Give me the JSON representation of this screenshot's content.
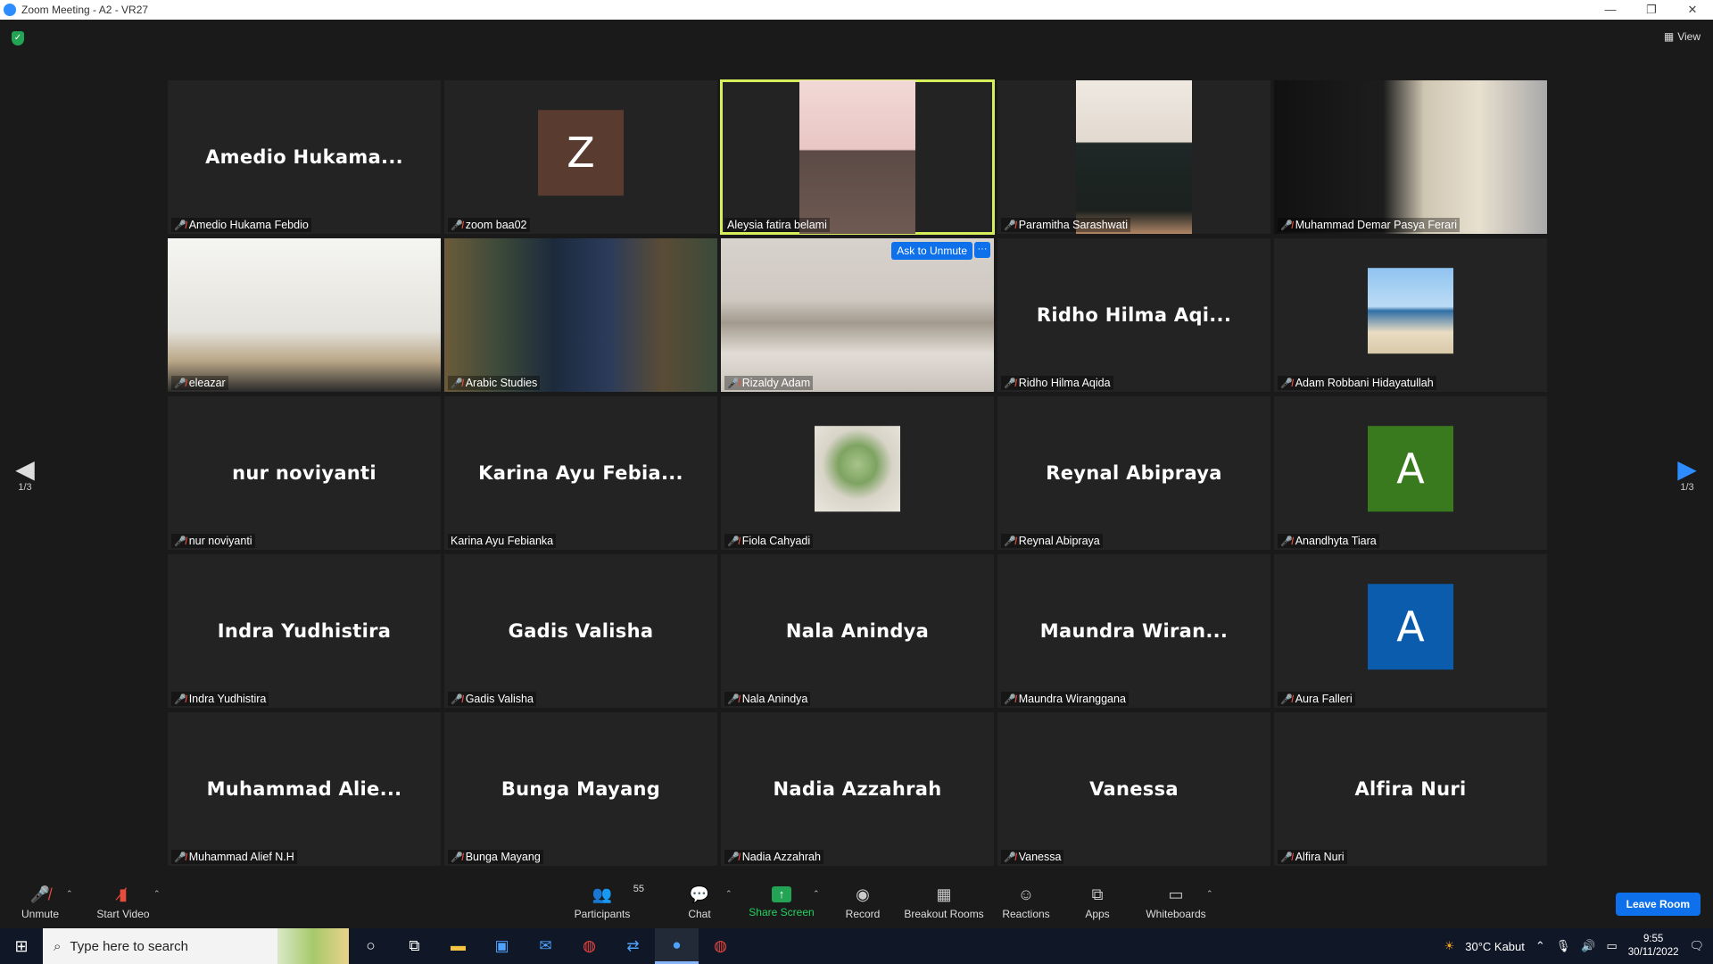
{
  "window": {
    "title": "Zoom Meeting - A2 - VR27",
    "controls": [
      "—",
      "❐",
      "✕"
    ]
  },
  "view_button": {
    "label": "View"
  },
  "pagination": {
    "left": "1/3",
    "right": "1/3"
  },
  "tiles": [
    {
      "big": "Amedio  Hukama...",
      "label": "Amedio Hukama Febdio",
      "muted": true,
      "kind": "name"
    },
    {
      "big": "",
      "label": "zoom baa02",
      "muted": true,
      "kind": "avatar",
      "letter": "Z",
      "color": "#5a3b30"
    },
    {
      "big": "",
      "label": "Aleysia fatira belami",
      "muted": false,
      "kind": "video-person",
      "active": true
    },
    {
      "big": "",
      "label": "Paramitha Sarashwati",
      "muted": true,
      "kind": "video-person2"
    },
    {
      "big": "",
      "label": "Muhammad Demar Pasya Ferari",
      "muted": true,
      "kind": "video-room"
    },
    {
      "big": "",
      "label": "eleazar",
      "muted": true,
      "kind": "video-ceiling"
    },
    {
      "big": "",
      "label": "Arabic Studies",
      "muted": true,
      "kind": "video-books"
    },
    {
      "big": "",
      "label": "Rizaldy Adam",
      "muted": true,
      "kind": "video-blur",
      "ask_unmute": "Ask to Unmute",
      "more": "···"
    },
    {
      "big": "Ridho  Hilma  Aqi...",
      "label": "Ridho Hilma Aqida",
      "muted": true,
      "kind": "name"
    },
    {
      "big": "",
      "label": "Adam Robbani Hidayatullah",
      "muted": true,
      "kind": "avatar-beach"
    },
    {
      "big": "nur noviyanti",
      "label": "nur noviyanti",
      "muted": true,
      "kind": "name"
    },
    {
      "big": "Karina  Ayu  Febia...",
      "label": "Karina Ayu Febianka",
      "muted": false,
      "kind": "name"
    },
    {
      "big": "",
      "label": "Fiola Cahyadi",
      "muted": true,
      "kind": "avatar-yoda"
    },
    {
      "big": "Reynal Abipraya",
      "label": "Reynal Abipraya",
      "muted": true,
      "kind": "name"
    },
    {
      "big": "",
      "label": "Anandhyta Tiara",
      "muted": true,
      "kind": "avatar",
      "letter": "A",
      "color": "#3a7a1f"
    },
    {
      "big": "Indra Yudhistira",
      "label": "Indra Yudhistira",
      "muted": true,
      "kind": "name"
    },
    {
      "big": "Gadis Valisha",
      "label": "Gadis Valisha",
      "muted": true,
      "kind": "name"
    },
    {
      "big": "Nala Anindya",
      "label": "Nala Anindya",
      "muted": true,
      "kind": "name"
    },
    {
      "big": "Maundra  Wiran...",
      "label": "Maundra Wiranggana",
      "muted": true,
      "kind": "name"
    },
    {
      "big": "",
      "label": "Aura Falleri",
      "muted": true,
      "kind": "avatar",
      "letter": "A",
      "color": "#0b5cad"
    },
    {
      "big": "Muhammad  Alie...",
      "label": "Muhammad Alief N.H",
      "muted": true,
      "kind": "name"
    },
    {
      "big": "Bunga Mayang",
      "label": "Bunga Mayang",
      "muted": true,
      "kind": "name"
    },
    {
      "big": "Nadia Azzahrah",
      "label": "Nadia Azzahrah",
      "muted": true,
      "kind": "name"
    },
    {
      "big": "Vanessa",
      "label": "Vanessa",
      "muted": true,
      "kind": "name"
    },
    {
      "big": "Alfira Nuri",
      "label": "Alfira Nuri",
      "muted": true,
      "kind": "name"
    }
  ],
  "toolbar": {
    "unmute": "Unmute",
    "start_video": "Start Video",
    "participants": "Participants",
    "participants_count": "55",
    "chat": "Chat",
    "share_screen": "Share Screen",
    "record": "Record",
    "breakout_rooms": "Breakout Rooms",
    "reactions": "Reactions",
    "apps": "Apps",
    "whiteboards": "Whiteboards",
    "leave_room": "Leave Room"
  },
  "taskbar": {
    "search_placeholder": "Type here to search",
    "weather": "30°C  Kabut",
    "time": "9:55",
    "date": "30/11/2022"
  },
  "colors": {
    "accent": "#0e71eb",
    "active_speaker": "#d6f05c",
    "muted": "#e74c3c",
    "share": "#23a455"
  }
}
